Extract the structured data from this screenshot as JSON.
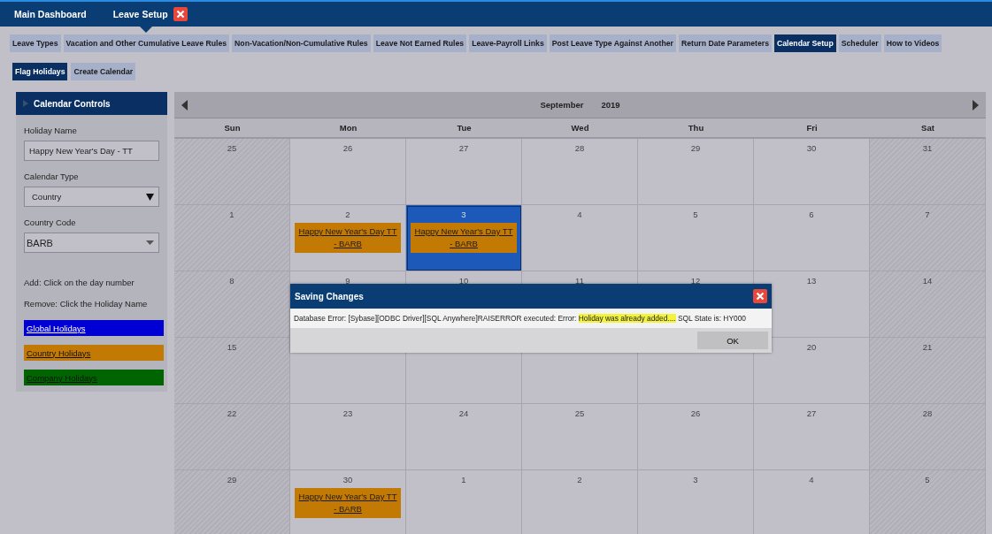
{
  "top_tabs": [
    {
      "label": "Main Dashboard",
      "selected": false,
      "closable": false
    },
    {
      "label": "Leave Setup",
      "selected": true,
      "closable": true
    }
  ],
  "tabs": [
    {
      "label": "Leave Types",
      "selected": false
    },
    {
      "label": "Vacation and Other Cumulative Leave Rules",
      "selected": false
    },
    {
      "label": "Non-Vacation/Non-Cumulative Rules",
      "selected": false
    },
    {
      "label": "Leave Not Earned Rules",
      "selected": false
    },
    {
      "label": "Leave-Payroll Links",
      "selected": false
    },
    {
      "label": "Post Leave Type Against Another",
      "selected": false
    },
    {
      "label": "Return Date Parameters",
      "selected": false
    },
    {
      "label": "Calendar Setup",
      "selected": true
    },
    {
      "label": "Scheduler",
      "selected": false
    },
    {
      "label": "How to Videos",
      "selected": false
    }
  ],
  "sub_tabs": [
    {
      "label": "Flag Holidays",
      "selected": true
    },
    {
      "label": "Create Calendar",
      "selected": false
    }
  ],
  "sidebar": {
    "title": "Calendar Controls",
    "fields": [
      {
        "kind": "text",
        "label": "Holiday Name",
        "value": "Happy New Year's Day - TT"
      },
      {
        "kind": "select",
        "label": "Calendar Type",
        "value": "Country"
      },
      {
        "kind": "combo",
        "label": "Country Code",
        "value": "BARB"
      }
    ],
    "notes": [
      "Add: Click on the day number",
      "Remove: Click the Holiday Name"
    ],
    "legend": [
      {
        "label": "Global Holidays",
        "color": "#0000d4"
      },
      {
        "label": "Country Holidays",
        "color": "#c27a04"
      },
      {
        "label": "Company Holidays",
        "color": "#006400"
      }
    ]
  },
  "calendar": {
    "month": "September",
    "year": "2019",
    "weekdays": [
      "Sun",
      "Mon",
      "Tue",
      "Wed",
      "Thu",
      "Fri",
      "Sat"
    ],
    "weeks": [
      [
        {
          "day": "25",
          "selected": false
        },
        {
          "day": "26",
          "selected": false
        },
        {
          "day": "27",
          "selected": false
        },
        {
          "day": "28",
          "selected": false
        },
        {
          "day": "29",
          "selected": false
        },
        {
          "day": "30",
          "selected": false
        },
        {
          "day": "31",
          "selected": false
        }
      ],
      [
        {
          "day": "1",
          "selected": false
        },
        {
          "day": "2",
          "selected": false,
          "holidays": [
            {
              "label": "Happy New Year's Day TT - BARB",
              "color": "#c27a04"
            }
          ]
        },
        {
          "day": "3",
          "selected": true,
          "holidays": [
            {
              "label": "Happy New Year's Day TT - BARB",
              "color": "#c27a04"
            }
          ]
        },
        {
          "day": "4",
          "selected": false
        },
        {
          "day": "5",
          "selected": false
        },
        {
          "day": "6",
          "selected": false
        },
        {
          "day": "7",
          "selected": false
        }
      ],
      [
        {
          "day": "8",
          "selected": false
        },
        {
          "day": "9",
          "selected": false
        },
        {
          "day": "10",
          "selected": false
        },
        {
          "day": "11",
          "selected": false
        },
        {
          "day": "12",
          "selected": false
        },
        {
          "day": "13",
          "selected": false
        },
        {
          "day": "14",
          "selected": false
        }
      ],
      [
        {
          "day": "15",
          "selected": false
        },
        {
          "selected": false
        },
        {
          "selected": false
        },
        {
          "selected": false
        },
        {
          "selected": false
        },
        {
          "day": "20",
          "selected": false
        },
        {
          "day": "21",
          "selected": false
        }
      ],
      [
        {
          "day": "22",
          "selected": false
        },
        {
          "day": "23",
          "selected": false
        },
        {
          "day": "24",
          "selected": false
        },
        {
          "day": "25",
          "selected": false
        },
        {
          "day": "26",
          "selected": false
        },
        {
          "day": "27",
          "selected": false
        },
        {
          "day": "28",
          "selected": false
        }
      ],
      [
        {
          "day": "29",
          "selected": false
        },
        {
          "day": "30",
          "selected": false,
          "holidays": [
            {
              "label": "Happy New Year's Day TT - BARB",
              "color": "#c27a04"
            }
          ]
        },
        {
          "day": "1",
          "selected": false
        },
        {
          "day": "2",
          "selected": false
        },
        {
          "day": "3",
          "selected": false
        },
        {
          "day": "4",
          "selected": false
        },
        {
          "day": "5",
          "selected": false
        }
      ]
    ]
  },
  "dialog": {
    "title": "Saving Changes",
    "message": "Database Error: [Sybase][ODBC Driver][SQL Anywhere]RAISERROR executed: Error: ",
    "highlight": "Holiday was already added....",
    "message_end": " SQL State is: HY000",
    "button": "OK"
  }
}
